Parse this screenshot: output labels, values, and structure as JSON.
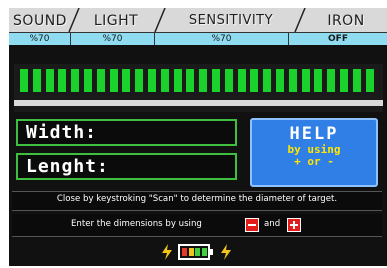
{
  "tabs": [
    {
      "label": "SOUND",
      "value": "%70"
    },
    {
      "label": "LIGHT",
      "value": "%70"
    },
    {
      "label": "SENSITIVITY",
      "value": "%70"
    },
    {
      "label": "IRON",
      "value": "OFF"
    }
  ],
  "meter": {
    "segments": 28,
    "color": "#1bd12c"
  },
  "fields": {
    "width_label": "Width:",
    "length_label": "Lenght:"
  },
  "help": {
    "title": "HELP",
    "line1": "by using",
    "line2": "+ or -"
  },
  "info_text": "Close by keystroking \"Scan\" to determine the diameter of target.",
  "dimensions": {
    "prefix": "Enter the dimensions by using",
    "middle": "and"
  },
  "battery": {
    "cells": [
      "#e23b2b",
      "#f2c41a",
      "#3fcf3f",
      "#3fcf3f"
    ]
  },
  "colors": {
    "accent_blue": "#2f7fe6",
    "field_border": "#3fbf3f",
    "value_strip": "#8fdcf0"
  }
}
